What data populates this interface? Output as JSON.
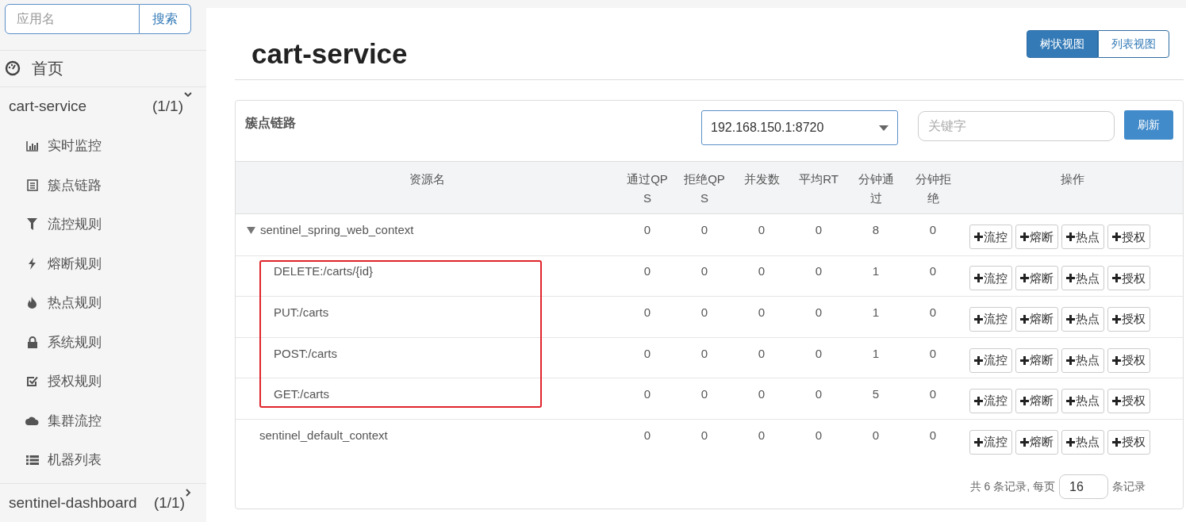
{
  "sidebar": {
    "search": {
      "placeholder": "应用名",
      "button": "搜索"
    },
    "home": {
      "label": "首页"
    },
    "apps": [
      {
        "name": "cart-service",
        "count": "(1/1)",
        "expanded": true,
        "items": [
          {
            "label": "实时监控",
            "kind": "monitor"
          },
          {
            "label": "簇点链路",
            "kind": "resources"
          },
          {
            "label": "流控规则",
            "kind": "flow"
          },
          {
            "label": "熔断规则",
            "kind": "degrade"
          },
          {
            "label": "热点规则",
            "kind": "hotspot"
          },
          {
            "label": "系统规则",
            "kind": "system"
          },
          {
            "label": "授权规则",
            "kind": "auth"
          },
          {
            "label": "集群流控",
            "kind": "cluster"
          },
          {
            "label": "机器列表",
            "kind": "machines"
          }
        ]
      },
      {
        "name": "sentinel-dashboard",
        "count": "(1/1)",
        "expanded": false
      }
    ]
  },
  "page": {
    "title": "cart-service",
    "views": [
      {
        "label": "树状视图",
        "selected": true
      },
      {
        "label": "列表视图",
        "selected": false
      }
    ]
  },
  "panel": {
    "title": "簇点链路",
    "machine": "192.168.150.1:8720",
    "keyword_placeholder": "关键字",
    "refresh": "刷新",
    "columns": [
      "资源名",
      "通过QPS",
      "拒绝QPS",
      "并发数",
      "平均RT",
      "分钟通过",
      "分钟拒绝",
      "操作"
    ],
    "rows": [
      {
        "name": "sentinel_spring_web_context",
        "values": [
          "0",
          "0",
          "0",
          "0",
          "8",
          "0"
        ],
        "actions": [
          "流控",
          "熔断",
          "热点",
          "授权"
        ],
        "expanded": true,
        "highlighted": false,
        "children": [
          {
            "name": "DELETE:/carts/{id}",
            "values": [
              "0",
              "0",
              "0",
              "0",
              "1",
              "0"
            ],
            "actions": [
              "流控",
              "熔断",
              "热点",
              "授权"
            ],
            "highlighted": true
          },
          {
            "name": "PUT:/carts",
            "values": [
              "0",
              "0",
              "0",
              "0",
              "1",
              "0"
            ],
            "actions": [
              "流控",
              "熔断",
              "热点",
              "授权"
            ],
            "highlighted": true
          },
          {
            "name": "POST:/carts",
            "values": [
              "0",
              "0",
              "0",
              "0",
              "1",
              "0"
            ],
            "actions": [
              "流控",
              "熔断",
              "热点",
              "授权"
            ],
            "highlighted": true
          },
          {
            "name": "GET:/carts",
            "values": [
              "0",
              "0",
              "0",
              "0",
              "5",
              "0"
            ],
            "actions": [
              "流控",
              "熔断",
              "热点",
              "授权"
            ],
            "highlighted": true
          }
        ]
      },
      {
        "name": "sentinel_default_context",
        "values": [
          "0",
          "0",
          "0",
          "0",
          "0",
          "0"
        ],
        "actions": [
          "流控",
          "熔断",
          "热点",
          "授权"
        ],
        "highlighted": false
      }
    ],
    "footer": {
      "before": "共 6 条记录, 每页",
      "page_size": "16",
      "after": "条记录"
    }
  }
}
